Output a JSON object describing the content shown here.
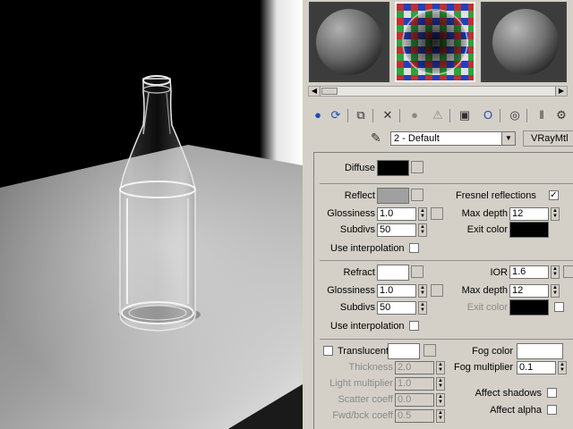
{
  "material_editor": {
    "slots": [
      {
        "name": "sphere-slot-1",
        "active": false
      },
      {
        "name": "sphere-slot-2",
        "active": true
      },
      {
        "name": "sphere-slot-3",
        "active": false
      }
    ],
    "material_name": "2 - Default",
    "material_type": "VRayMtl"
  },
  "diffuse": {
    "label": "Diffuse",
    "color": "#000000"
  },
  "reflection": {
    "reflect_label": "Reflect",
    "reflect_color": "#a0a0a0",
    "fresnel_label": "Fresnel reflections",
    "fresnel_checked": "✓",
    "glossiness_label": "Glossiness",
    "glossiness_value": "1.0",
    "max_depth_label": "Max depth",
    "max_depth_value": "12",
    "subdivs_label": "Subdivs",
    "subdivs_value": "50",
    "exit_color_label": "Exit color",
    "exit_color": "#000000",
    "use_interp_label": "Use interpolation"
  },
  "refraction": {
    "refract_label": "Refract",
    "refract_color": "#ffffff",
    "ior_label": "IOR",
    "ior_value": "1.6",
    "glossiness_label": "Glossiness",
    "glossiness_value": "1.0",
    "max_depth_label": "Max depth",
    "max_depth_value": "12",
    "subdivs_label": "Subdivs",
    "subdivs_value": "50",
    "exit_color_label": "Exit color",
    "exit_color": "#000000",
    "use_interp_label": "Use interpolation"
  },
  "translucency": {
    "translucent_label": "Translucent",
    "translucent_color": "#ffffff",
    "fog_color_label": "Fog color",
    "fog_color": "#ffffff",
    "thickness_label": "Thickness",
    "thickness_value": "2.0",
    "fog_multiplier_label": "Fog multiplier",
    "fog_multiplier_value": "0.1",
    "light_multiplier_label": "Light multiplier",
    "light_multiplier_value": "1.0",
    "scatter_coeff_label": "Scatter coeff",
    "scatter_coeff_value": "0.0",
    "affect_shadows_label": "Affect shadows",
    "fwd_bck_label": "Fwd/bck coeff",
    "fwd_bck_value": "0.5",
    "affect_alpha_label": "Affect alpha"
  }
}
